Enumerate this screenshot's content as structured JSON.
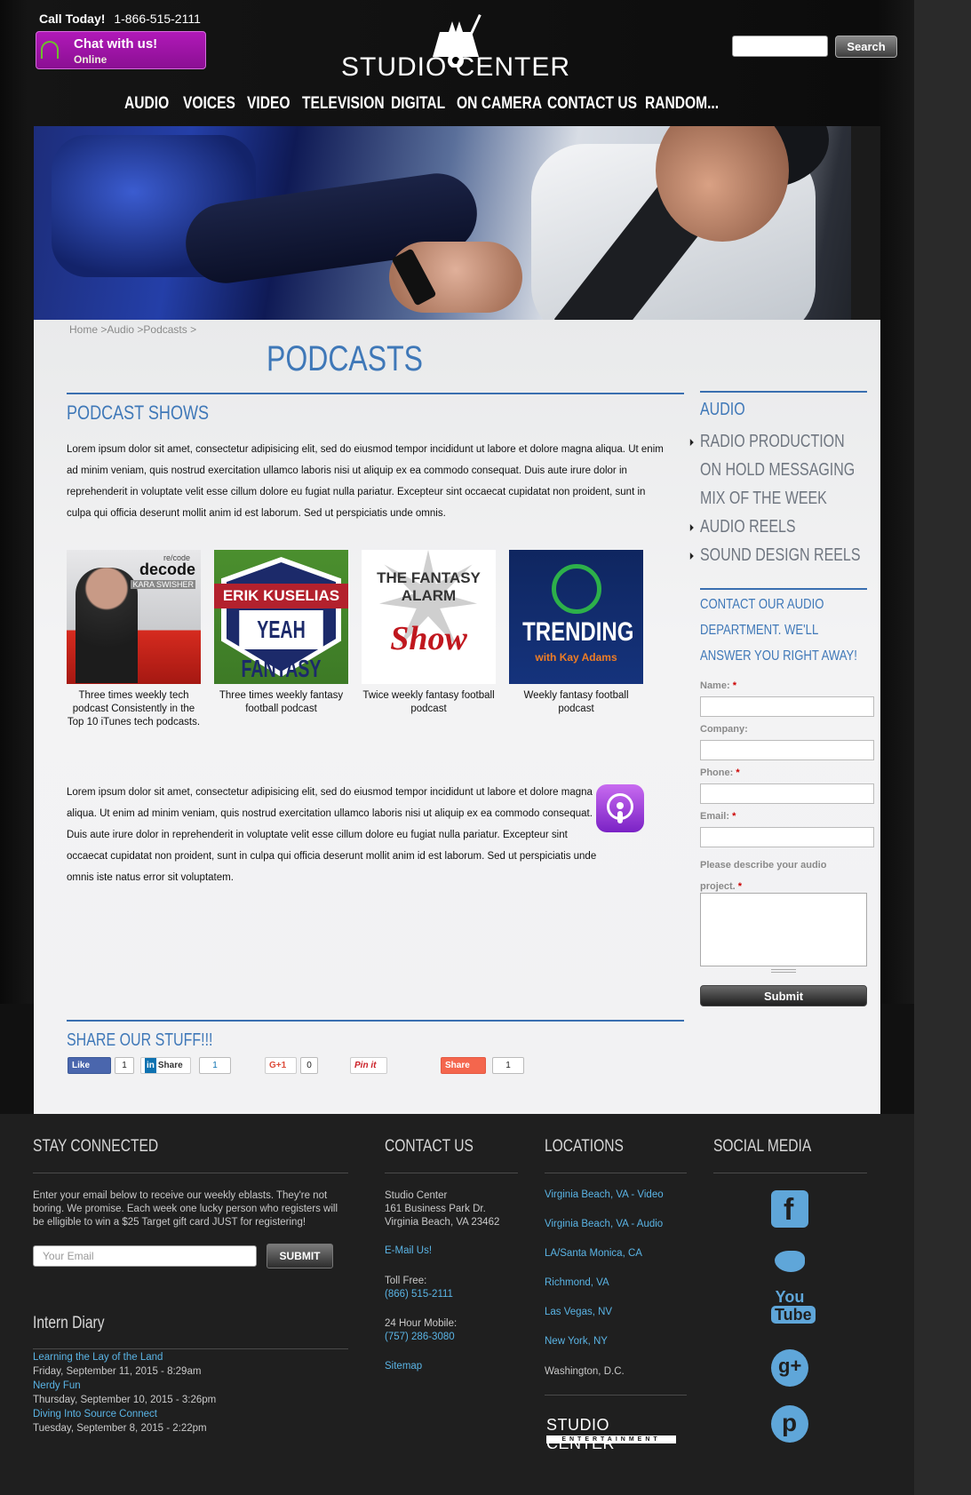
{
  "header": {
    "call_label": "Call Today!",
    "call_phone": "1-866-515-2111",
    "chat_title": "Chat with us!",
    "chat_status": "Online",
    "logo_text": "STUDIO CENTER",
    "search_placeholder": "",
    "search_button": "Search"
  },
  "nav": [
    "AUDIO",
    "VOICES",
    "VIDEO",
    "TELEVISION",
    "DIGITAL",
    "ON CAMERA",
    "CONTACT US",
    "RANDOM..."
  ],
  "breadcrumb": "Home >Audio >Podcasts >",
  "page_title": "PODCASTS",
  "section_heading": "PODCAST SHOWS",
  "paragraph_1": "Lorem ipsum dolor sit amet, consectetur adipisicing elit, sed do eiusmod tempor incididunt ut labore et dolore magna aliqua. Ut enim ad minim veniam, quis nostrud exercitation ullamco laboris nisi ut aliquip ex ea commodo consequat. Duis aute irure dolor in reprehenderit in voluptate velit esse cillum dolore eu fugiat nulla pariatur. Excepteur sint occaecat cupidatat non proident, sunt in culpa qui officia deserunt mollit anim id est laborum. Sed ut perspiciatis unde omnis.",
  "shows": [
    {
      "caption": "Three times weekly tech podcast Consistently in the Top 10 iTunes tech podcasts.",
      "art_brand_top": "re/code",
      "art_brand": "decode",
      "art_sub": "KARA SWISHER"
    },
    {
      "caption": "Three times weekly fantasy football podcast",
      "art_band": "ERIK KUSELIAS",
      "art_big": "YEAH FANTASY"
    },
    {
      "caption": "Twice weekly fantasy football podcast",
      "art_t1": "THE FANTASY ALARM",
      "art_t2": "Show"
    },
    {
      "caption": "Weekly fantasy football podcast",
      "art_t1": "TRENDING",
      "art_t2": "with Kay Adams"
    }
  ],
  "paragraph_2": "Lorem ipsum dolor sit amet, consectetur adipisicing elit, sed do eiusmod tempor incididunt ut labore et dolore magna aliqua. Ut enim ad minim veniam, quis nostrud exercitation ullamco laboris nisi ut aliquip ex ea commodo consequat. Duis aute irure dolor in reprehenderit in voluptate velit esse cillum dolore eu fugiat nulla pariatur. Excepteur sint occaecat cupidatat non proident, sunt in culpa qui officia deserunt mollit anim id est laborum. Sed ut perspiciatis unde omnis iste natus error sit voluptatem.",
  "share": {
    "heading": "SHARE OUR STUFF!!!",
    "fb_label": "Like",
    "fb_count": "1",
    "li_icon": "in",
    "li_label": "Share",
    "li_count": "1",
    "gp_label": "G+1",
    "gp_count": "0",
    "pin_label": "Pin it",
    "as_label": "Share",
    "as_count": "1"
  },
  "sidebar": {
    "heading": "AUDIO",
    "items": [
      {
        "label": "RADIO PRODUCTION"
      },
      {
        "label": "ON HOLD MESSAGING"
      },
      {
        "label": "MIX OF THE WEEK"
      },
      {
        "label": "AUDIO REELS"
      },
      {
        "label": "SOUND DESIGN REELS"
      }
    ],
    "contact_heading": "CONTACT OUR AUDIO DEPARTMENT. WE'LL ANSWER YOU RIGHT AWAY!",
    "form": {
      "name_label": "Name:",
      "company_label": "Company:",
      "phone_label": "Phone:",
      "email_label": "Email:",
      "project_label": "Please describe your audio project.",
      "required_mark": "*",
      "submit": "Submit"
    }
  },
  "footer": {
    "stay_connected": {
      "heading": "STAY CONNECTED",
      "text": "Enter your email below to receive our weekly eblasts. They're not boring. We promise. Each week one lucky person who registers will be elligible to win a $25 Target gift card JUST for registering!",
      "email_placeholder": "Your Email",
      "submit": "SUBMIT"
    },
    "intern_diary": {
      "heading": "Intern Diary",
      "entries": [
        {
          "title": "Learning the Lay of the Land",
          "date": "Friday, September 11, 2015 - 8:29am"
        },
        {
          "title": "Nerdy Fun",
          "date": "Thursday, September 10, 2015 - 3:26pm"
        },
        {
          "title": "Diving Into Source Connect",
          "date": "Tuesday, September 8, 2015 - 2:22pm"
        }
      ]
    },
    "contact": {
      "heading": "CONTACT US",
      "name": "Studio Center",
      "address1": "161 Business Park Dr.",
      "address2": "Virginia Beach, VA 23462",
      "email_link": "E-Mail Us!",
      "tollfree_label": "Toll Free:",
      "tollfree": "(866) 515-2111",
      "mobile_label": "24 Hour Mobile:",
      "mobile": "(757) 286-3080",
      "sitemap": "Sitemap"
    },
    "locations": {
      "heading": "LOCATIONS",
      "items": [
        {
          "label": "Virginia Beach, VA - Video"
        },
        {
          "label": "Virginia Beach, VA - Audio"
        },
        {
          "label": "LA/Santa Monica, CA"
        },
        {
          "label": "Richmond, VA"
        },
        {
          "label": "Las Vegas, NV"
        },
        {
          "label": "New York, NY"
        },
        {
          "label": "Washington, D.C."
        }
      ],
      "logo_text": "STUDIO CENTER",
      "logo_sub": "ENTERTAINMENT"
    },
    "social": {
      "heading": "SOCIAL MEDIA",
      "icons": [
        "facebook-icon",
        "twitter-icon",
        "youtube-icon",
        "google-plus-icon",
        "pinterest-icon"
      ],
      "fb_glyph": "f",
      "yt_top": "You",
      "yt_bottom": "Tube",
      "gp_glyph": "g+",
      "pin_glyph": "p"
    }
  },
  "colors": {
    "accent": "#3f78b8",
    "link": "#5ab4e5",
    "chat": "#a315ab"
  }
}
